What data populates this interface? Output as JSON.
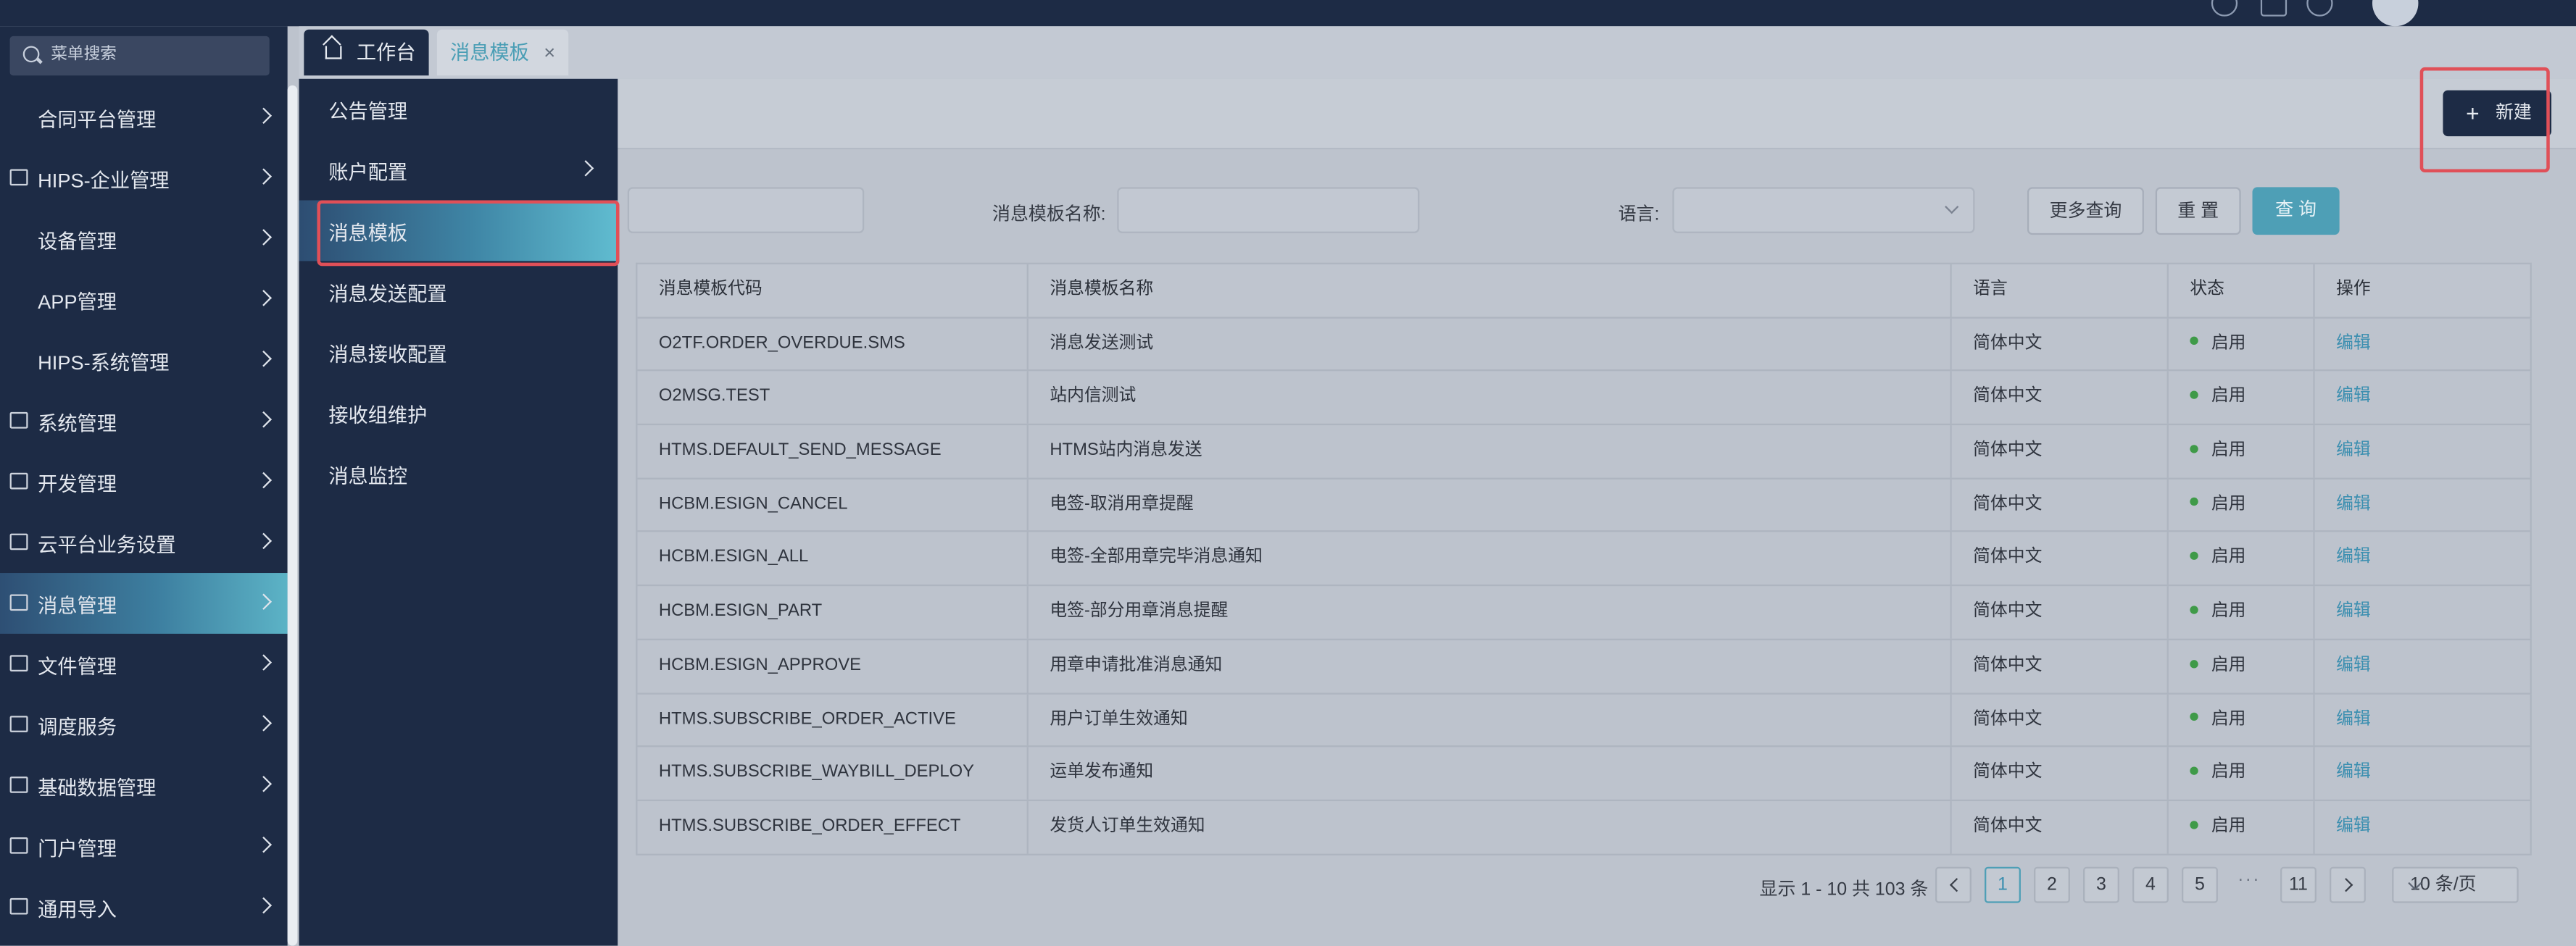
{
  "colors": {
    "sidebar_bg": "#1d2b45",
    "accent": "#4e9fb6",
    "link": "#3c8fb0",
    "status_enabled": "#3f9a48",
    "highlight_box": "#e05058"
  },
  "sidebar": {
    "search_placeholder": "菜单搜索",
    "items": [
      {
        "label": "合同平台管理",
        "icon": ""
      },
      {
        "label": "HIPS-企业管理",
        "icon": "building-icon"
      },
      {
        "label": "设备管理",
        "icon": ""
      },
      {
        "label": "APP管理",
        "icon": ""
      },
      {
        "label": "HIPS-系统管理",
        "icon": ""
      },
      {
        "label": "系统管理",
        "icon": "monitor-icon"
      },
      {
        "label": "开发管理",
        "icon": "code-icon"
      },
      {
        "label": "云平台业务设置",
        "icon": "home-icon"
      },
      {
        "label": "消息管理",
        "icon": "message-icon",
        "active": true
      },
      {
        "label": "文件管理",
        "icon": "file-icon"
      },
      {
        "label": "调度服务",
        "icon": "sliders-icon"
      },
      {
        "label": "基础数据管理",
        "icon": "database-icon"
      },
      {
        "label": "门户管理",
        "icon": "portal-icon"
      },
      {
        "label": "通用导入",
        "icon": "import-icon"
      }
    ]
  },
  "submenu": {
    "items": [
      {
        "label": "公告管理"
      },
      {
        "label": "账户配置",
        "has_children": true
      },
      {
        "label": "消息模板",
        "active": true
      },
      {
        "label": "消息发送配置"
      },
      {
        "label": "消息接收配置"
      },
      {
        "label": "接收组维护"
      },
      {
        "label": "消息监控"
      }
    ]
  },
  "tabs": {
    "home_label": "工作台",
    "active_label": "消息模板",
    "close_glyph": "×"
  },
  "toolbar": {
    "new_label": "新建",
    "plus_glyph": "+"
  },
  "filters": {
    "name_label": "消息模板名称:",
    "lang_label": "语言:",
    "more_label": "更多查询",
    "reset_label": "重 置",
    "query_label": "查 询"
  },
  "table": {
    "headers": {
      "code": "消息模板代码",
      "name": "消息模板名称",
      "lang": "语言",
      "status": "状态",
      "op": "操作"
    },
    "rows": [
      {
        "code": "O2TF.ORDER_OVERDUE.SMS",
        "name": "消息发送测试",
        "lang": "简体中文",
        "status": "启用",
        "op": "编辑"
      },
      {
        "code": "O2MSG.TEST",
        "name": "站内信测试",
        "lang": "简体中文",
        "status": "启用",
        "op": "编辑"
      },
      {
        "code": "HTMS.DEFAULT_SEND_MESSAGE",
        "name": "HTMS站内消息发送",
        "lang": "简体中文",
        "status": "启用",
        "op": "编辑"
      },
      {
        "code": "HCBM.ESIGN_CANCEL",
        "name": "电签-取消用章提醒",
        "lang": "简体中文",
        "status": "启用",
        "op": "编辑"
      },
      {
        "code": "HCBM.ESIGN_ALL",
        "name": "电签-全部用章完毕消息通知",
        "lang": "简体中文",
        "status": "启用",
        "op": "编辑"
      },
      {
        "code": "HCBM.ESIGN_PART",
        "name": "电签-部分用章消息提醒",
        "lang": "简体中文",
        "status": "启用",
        "op": "编辑"
      },
      {
        "code": "HCBM.ESIGN_APPROVE",
        "name": "用章申请批准消息通知",
        "lang": "简体中文",
        "status": "启用",
        "op": "编辑"
      },
      {
        "code": "HTMS.SUBSCRIBE_ORDER_ACTIVE",
        "name": "用户订单生效通知",
        "lang": "简体中文",
        "status": "启用",
        "op": "编辑"
      },
      {
        "code": "HTMS.SUBSCRIBE_WAYBILL_DEPLOY",
        "name": "运单发布通知",
        "lang": "简体中文",
        "status": "启用",
        "op": "编辑"
      },
      {
        "code": "HTMS.SUBSCRIBE_ORDER_EFFECT",
        "name": "发货人订单生效通知",
        "lang": "简体中文",
        "status": "启用",
        "op": "编辑"
      }
    ]
  },
  "pagination": {
    "summary": "显示 1 - 10 共 103 条",
    "pages": [
      "1",
      "2",
      "3",
      "4",
      "5",
      "11"
    ],
    "current": "1",
    "ellipsis": "···",
    "page_size": "10 条/页"
  }
}
